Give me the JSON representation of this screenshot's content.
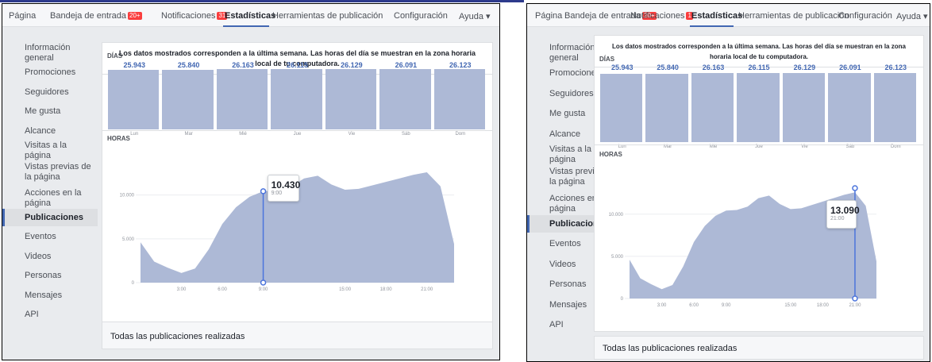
{
  "colors": {
    "accent": "#4267b2",
    "bar": "#adb9d6",
    "area": "#adb9d6",
    "line": "#4b74dc",
    "badge": "#fa3e3e"
  },
  "nav": {
    "pagina": "Página",
    "inbox": "Bandeja de entrada",
    "inbox_badge_a": "20+",
    "inbox_badge_b": "20+",
    "notif": "Notificaciones",
    "notif_badge_a": "31",
    "notif_badge_b": "1",
    "stats": "Estadísticas",
    "tools": "Herramientas de publicación",
    "config": "Configuración",
    "help": "Ayuda ▾"
  },
  "sidebar": {
    "items": [
      "Información general",
      "Promociones",
      "Seguidores",
      "Me gusta",
      "Alcance",
      "Visitas a la página",
      "Vistas previas de la página",
      "Acciones en la página",
      "Publicaciones",
      "Eventos",
      "Videos",
      "Personas",
      "Mensajes",
      "API"
    ],
    "active_index": 8
  },
  "intro": "Los datos mostrados corresponden a la última semana. Las horas del día se muestran en la zona horaria local de tu computadora.",
  "days_label": "DÍAS",
  "hours_label": "HORAS",
  "all_posts": "Todas las publicaciones realizadas",
  "chart_data": [
    {
      "type": "bar",
      "title": "DÍAS",
      "categories": [
        "Lun",
        "Mar",
        "Mié",
        "Jue",
        "Vie",
        "Sáb",
        "Dom"
      ],
      "values": [
        25943,
        25840,
        26163,
        26115,
        26129,
        26091,
        26123
      ],
      "value_labels": [
        "25.943",
        "25.840",
        "26.163",
        "26.115",
        "26.129",
        "26.091",
        "26.123"
      ]
    },
    {
      "type": "area",
      "title": "HORAS",
      "x": [
        0,
        1,
        2,
        3,
        4,
        5,
        6,
        7,
        8,
        9,
        10,
        11,
        12,
        13,
        14,
        15,
        16,
        17,
        18,
        19,
        20,
        21,
        22,
        23
      ],
      "y": [
        4600,
        2400,
        1700,
        1100,
        1600,
        3800,
        6700,
        8600,
        9800,
        10430,
        10500,
        10900,
        11900,
        12200,
        11200,
        10600,
        10700,
        11100,
        11500,
        11900,
        12300,
        12600,
        11000,
        4400
      ],
      "y_ticks": [
        0,
        5000,
        10000
      ],
      "y_tick_labels": [
        "0",
        "5.000",
        "10.000"
      ],
      "x_ticks": [
        3,
        6,
        9,
        15,
        18,
        21
      ],
      "x_tick_labels": [
        "3:00",
        "6:00",
        "9:00",
        "15:00",
        "18:00",
        "21:00"
      ],
      "ylim": [
        0,
        14500
      ],
      "grid": true
    }
  ],
  "tooltip_a": {
    "value": "10.430",
    "time": "9:00",
    "hour": 9
  },
  "tooltip_b": {
    "value": "13.090",
    "time": "21:00",
    "hour": 21
  }
}
